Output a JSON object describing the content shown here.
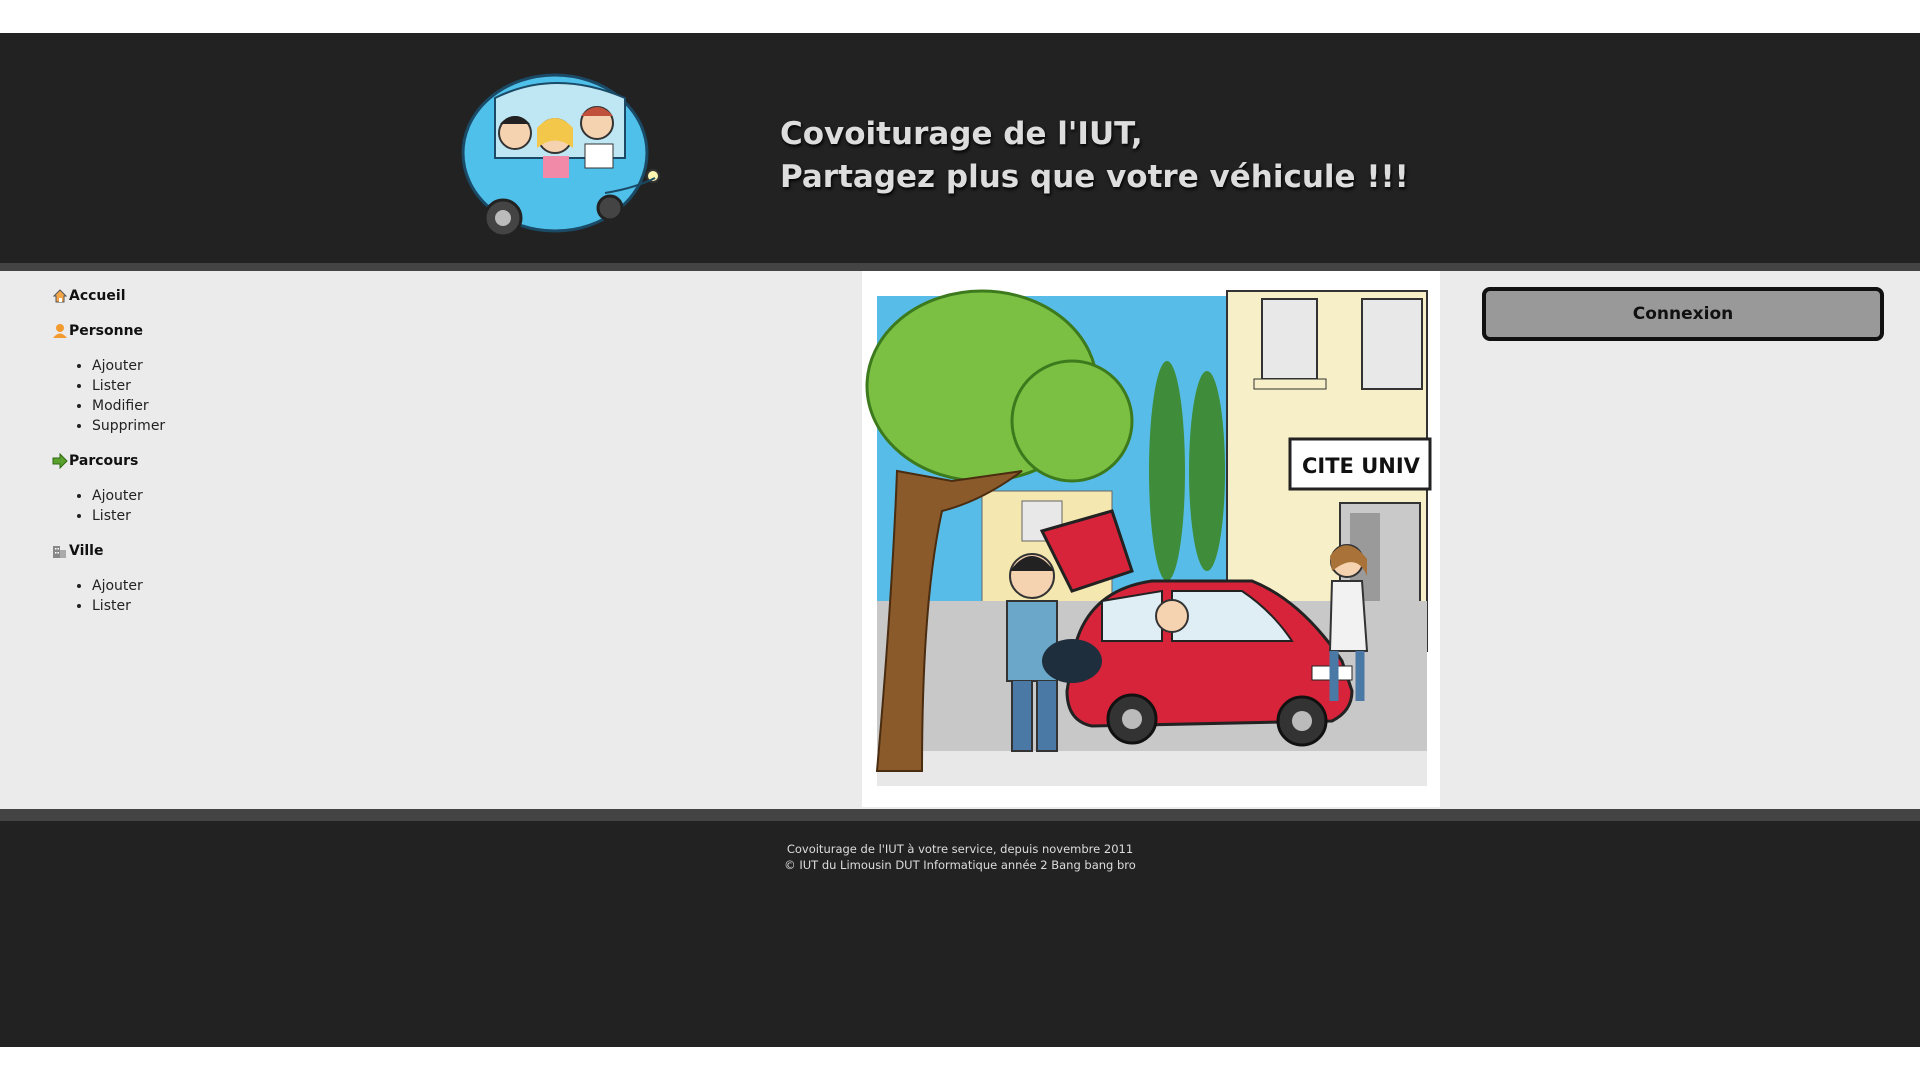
{
  "header": {
    "title_line1": "Covoiturage de l'IUT,",
    "title_line2": "Partagez plus que votre véhicule !!!"
  },
  "nav": {
    "accueil": {
      "label": "Accueil",
      "icon": "home-icon"
    },
    "personne": {
      "label": "Personne",
      "icon": "person-icon",
      "items": [
        "Ajouter",
        "Lister",
        "Modifier",
        "Supprimer"
      ]
    },
    "parcours": {
      "label": "Parcours",
      "icon": "arrow-right-icon",
      "items": [
        "Ajouter",
        "Lister"
      ]
    },
    "ville": {
      "label": "Ville",
      "icon": "building-icon",
      "items": [
        "Ajouter",
        "Lister"
      ]
    }
  },
  "illustration": {
    "sign_text": "CITE UNIV"
  },
  "login": {
    "button_label": "Connexion"
  },
  "footer": {
    "line1": "Covoiturage de l'IUT à votre service, depuis novembre 2011",
    "line2": "© IUT du Limousin DUT Informatique année 2 Bang bang bro"
  },
  "colors": {
    "header_bg": "#222222",
    "border": "#444444",
    "main_bg": "#ebebeb",
    "button_bg": "#999999",
    "car_blue": "#4fc0ea",
    "car_red": "#d8243a"
  }
}
